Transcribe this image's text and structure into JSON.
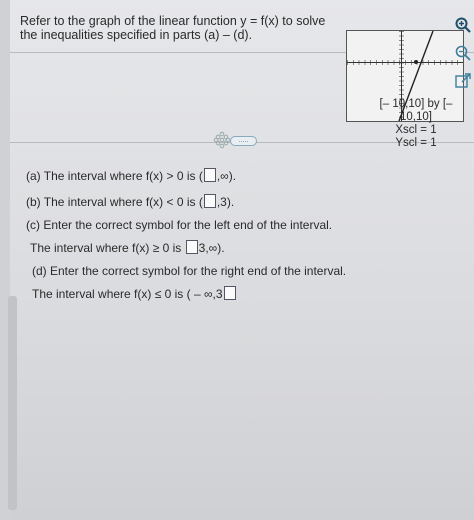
{
  "question": {
    "text": "Refer to the graph of the linear function y = f(x) to solve the inequalities specified in parts (a) – (d)."
  },
  "graph": {
    "window_line1": "[– 10,10] by [– 10,10]",
    "xscl": "Xscl = 1",
    "yscl": "Yscl = 1"
  },
  "parts": {
    "a": {
      "prefix": "(a) The interval where f(x) > 0 is (",
      "suffix": ",∞)."
    },
    "b": {
      "prefix": "(b) The interval where f(x) < 0 is (",
      "suffix": ",3)."
    },
    "c": {
      "text": "(c) Enter the correct symbol for the left end of the interval."
    },
    "c_answer": {
      "prefix": "The interval where f(x) ≥ 0 is ",
      "suffix": "3,∞)."
    },
    "d": {
      "text": "(d) Enter the correct symbol for the right end of the interval."
    },
    "d_answer": {
      "prefix": "The interval where f(x) ≤ 0 is ( – ∞,3",
      "suffix": ""
    }
  },
  "divider": {
    "label": "....."
  },
  "icons": [
    "zoom-in-icon",
    "zoom-out-icon",
    "popout-icon"
  ]
}
